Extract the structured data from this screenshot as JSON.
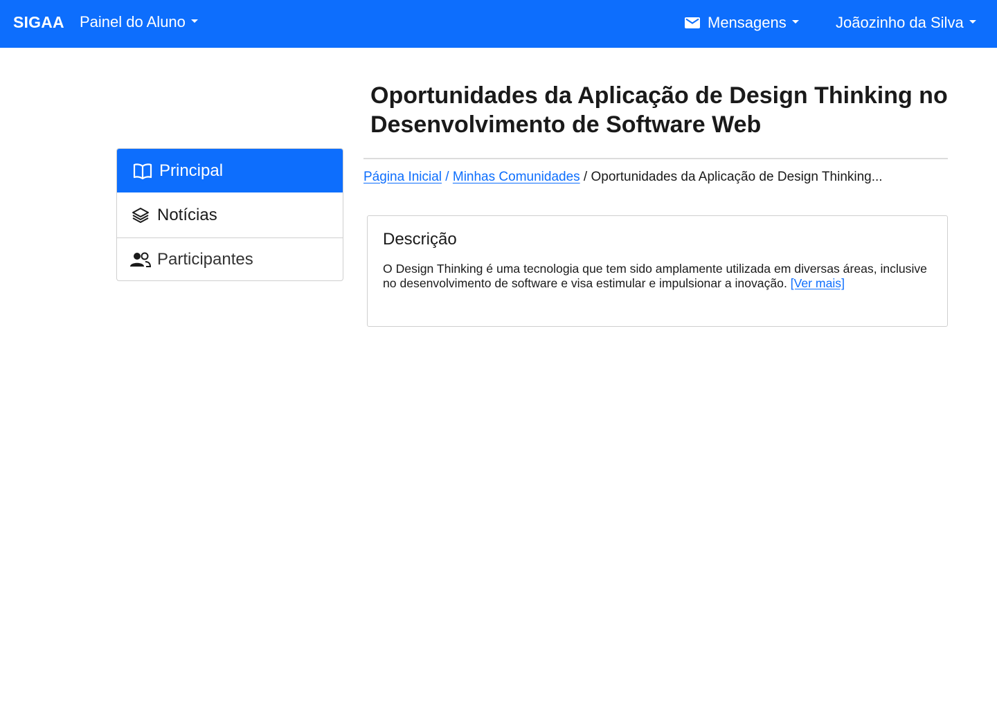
{
  "navbar": {
    "brand": "SIGAA",
    "painel_label": "Painel do Aluno",
    "mensagens_label": "Mensagens",
    "user_label": "Joãozinho da Silva"
  },
  "page": {
    "title": "Oportunidades da Aplicação de Design Thinking no Desenvolvimento de Software Web"
  },
  "breadcrumb": {
    "home": "Página Inicial",
    "separator_1": " / ",
    "communities": "Minhas Comunidades",
    "separator_2": " / ",
    "current": "Oportunidades da Aplicação de Design Thinking..."
  },
  "sidebar": {
    "items": [
      {
        "label": "Principal",
        "icon": "book-icon",
        "active": true
      },
      {
        "label": "Notícias",
        "icon": "layers-icon",
        "active": false
      },
      {
        "label": "Participantes",
        "icon": "users-icon",
        "active": false
      }
    ]
  },
  "description": {
    "heading": "Descrição",
    "text": "O Design Thinking é uma tecnologia que tem sido amplamente utilizada em diversas áreas, inclusive no desenvolvimento de software e visa estimular e impulsionar a inovação. ",
    "more_link": "[Ver mais]"
  },
  "colors": {
    "primary": "#0d6efd",
    "border": "#cfcfcf"
  }
}
